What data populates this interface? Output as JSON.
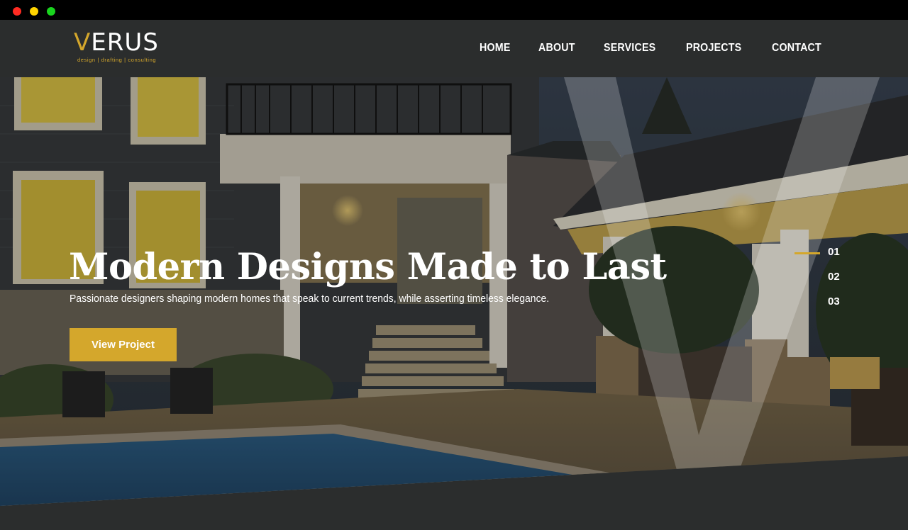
{
  "logo": {
    "brand_initial": "V",
    "brand_rest": "ERUS",
    "tagline": "design | drafting | consulting",
    "accent_color": "#d4a72c"
  },
  "nav": {
    "items": [
      {
        "label": "HOME"
      },
      {
        "label": "ABOUT"
      },
      {
        "label": "SERVICES"
      },
      {
        "label": "PROJECTS"
      },
      {
        "label": "CONTACT"
      }
    ]
  },
  "hero": {
    "title": "Modern Designs Made to Last",
    "subtitle": "Passionate designers shaping modern homes that speak to current trends, while asserting timeless elegance.",
    "cta_label": "View Project",
    "background_image": "photo of modern house with lit porch, pool and pavilion at dusk"
  },
  "slider": {
    "items": [
      {
        "label": "01",
        "active": true
      },
      {
        "label": "02",
        "active": false
      },
      {
        "label": "03",
        "active": false
      }
    ]
  },
  "colors": {
    "header_bg": "#2b2d2d",
    "accent": "#d4a72c",
    "text": "#ffffff"
  }
}
